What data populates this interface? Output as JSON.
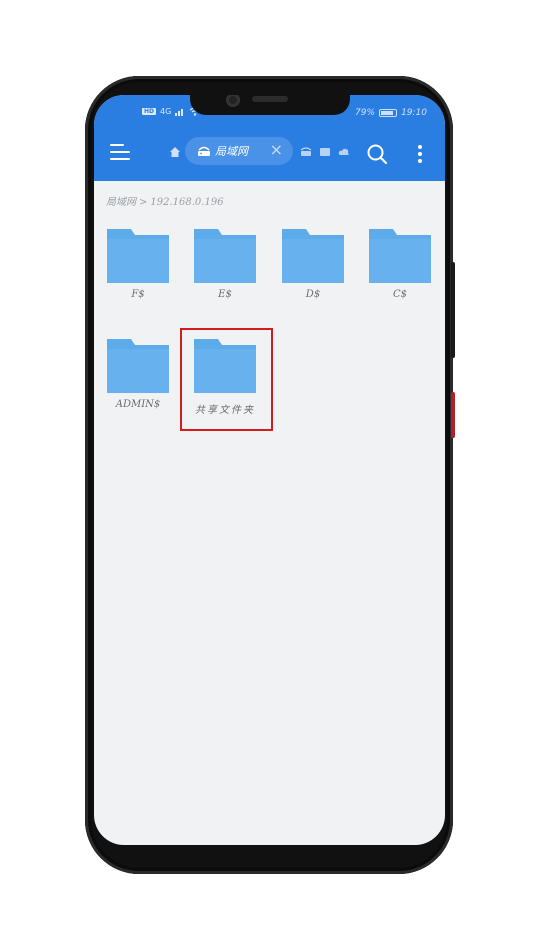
{
  "status_bar": {
    "signal_tag": "HD",
    "network_type": "4G",
    "battery_percent": "79%",
    "time": "19:10"
  },
  "toolbar": {
    "tab_label": "局域网"
  },
  "breadcrumb": {
    "root": "局域网",
    "separator": ">",
    "address": "192.168.0.196"
  },
  "folders": [
    {
      "name": "F$"
    },
    {
      "name": "E$"
    },
    {
      "name": "D$"
    },
    {
      "name": "C$"
    },
    {
      "name": "ADMIN$"
    },
    {
      "name": "共享文件夹"
    }
  ],
  "colors": {
    "toolbar_bg": "#2a7de1",
    "folder": "#5eabea",
    "highlight_border": "#d11d1d",
    "content_bg": "#f1f2f4"
  }
}
